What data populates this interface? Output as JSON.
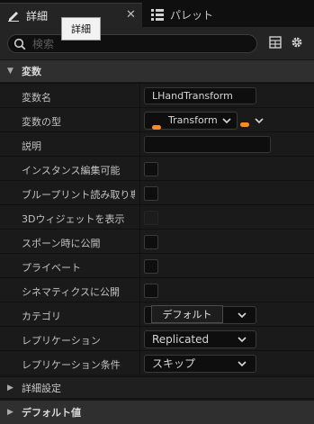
{
  "tabs": [
    {
      "label": "詳細",
      "icon": "pencil-icon",
      "active": true
    },
    {
      "label": "パレット",
      "icon": "palette-list-icon",
      "active": false
    }
  ],
  "tooltip": "詳細",
  "search": {
    "placeholder": "検索"
  },
  "sections": {
    "variables": "変数",
    "advanced": "詳細設定",
    "default_value": "デフォルト値"
  },
  "properties": {
    "variable_name": {
      "label": "変数名",
      "value": "LHandTransform"
    },
    "variable_type": {
      "label": "変数の型",
      "value": "Transform",
      "pin_color": "#ff8a1f"
    },
    "description": {
      "label": "説明",
      "value": ""
    },
    "instance_editable": {
      "label": "インスタンス編集可能",
      "checked": false
    },
    "blueprint_read_only": {
      "label": "ブループリント読み取り専用",
      "checked": false
    },
    "show_3d_widget": {
      "label": "3Dウィジェットを表示",
      "checked": false,
      "disabled": true
    },
    "expose_on_spawn": {
      "label": "スポーン時に公開",
      "checked": false
    },
    "private": {
      "label": "プライベート",
      "checked": false
    },
    "expose_to_cinematics": {
      "label": "シネマティクスに公開",
      "checked": false
    },
    "category": {
      "label": "カテゴリ",
      "value": "デフォルト"
    },
    "replication": {
      "label": "レプリケーション",
      "value": "Replicated"
    },
    "replication_condition": {
      "label": "レプリケーション条件",
      "value": "スキップ"
    }
  },
  "colors": {
    "accent_pin": "#ff8a1f",
    "panel_bg": "#1a1a1a",
    "header_bg": "#2f2f2f"
  }
}
